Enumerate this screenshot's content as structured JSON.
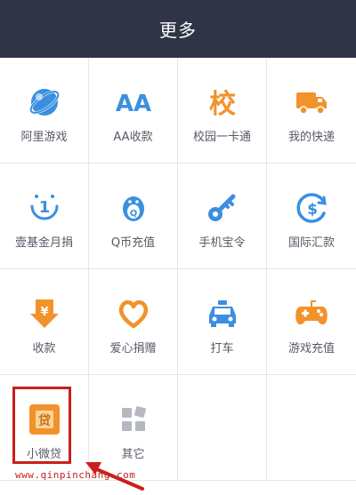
{
  "header": {
    "title": "更多"
  },
  "items": [
    {
      "label": "阿里游戏",
      "icon": "ali-game-icon"
    },
    {
      "label": "AA收款",
      "icon": "aa-collect-icon"
    },
    {
      "label": "校园一卡通",
      "icon": "campus-card-icon"
    },
    {
      "label": "我的快递",
      "icon": "express-truck-icon"
    },
    {
      "label": "壹基金月捐",
      "icon": "one-foundation-icon"
    },
    {
      "label": "Q币充值",
      "icon": "qq-penguin-icon"
    },
    {
      "label": "手机宝令",
      "icon": "phone-token-key-icon"
    },
    {
      "label": "国际汇款",
      "icon": "international-remit-icon"
    },
    {
      "label": "收款",
      "icon": "collect-money-icon"
    },
    {
      "label": "爱心捐赠",
      "icon": "charity-heart-icon"
    },
    {
      "label": "打车",
      "icon": "taxi-icon"
    },
    {
      "label": "游戏充值",
      "icon": "game-controller-icon"
    },
    {
      "label": "小微贷",
      "icon": "micro-loan-icon"
    },
    {
      "label": "其它",
      "icon": "others-grid-icon"
    }
  ],
  "watermark": "www.qinpinchang.com",
  "colors": {
    "header_bg": "#2f3447",
    "accent_blue": "#3b8fe0",
    "accent_orange": "#f2922b",
    "highlight_red": "#c8201c"
  }
}
